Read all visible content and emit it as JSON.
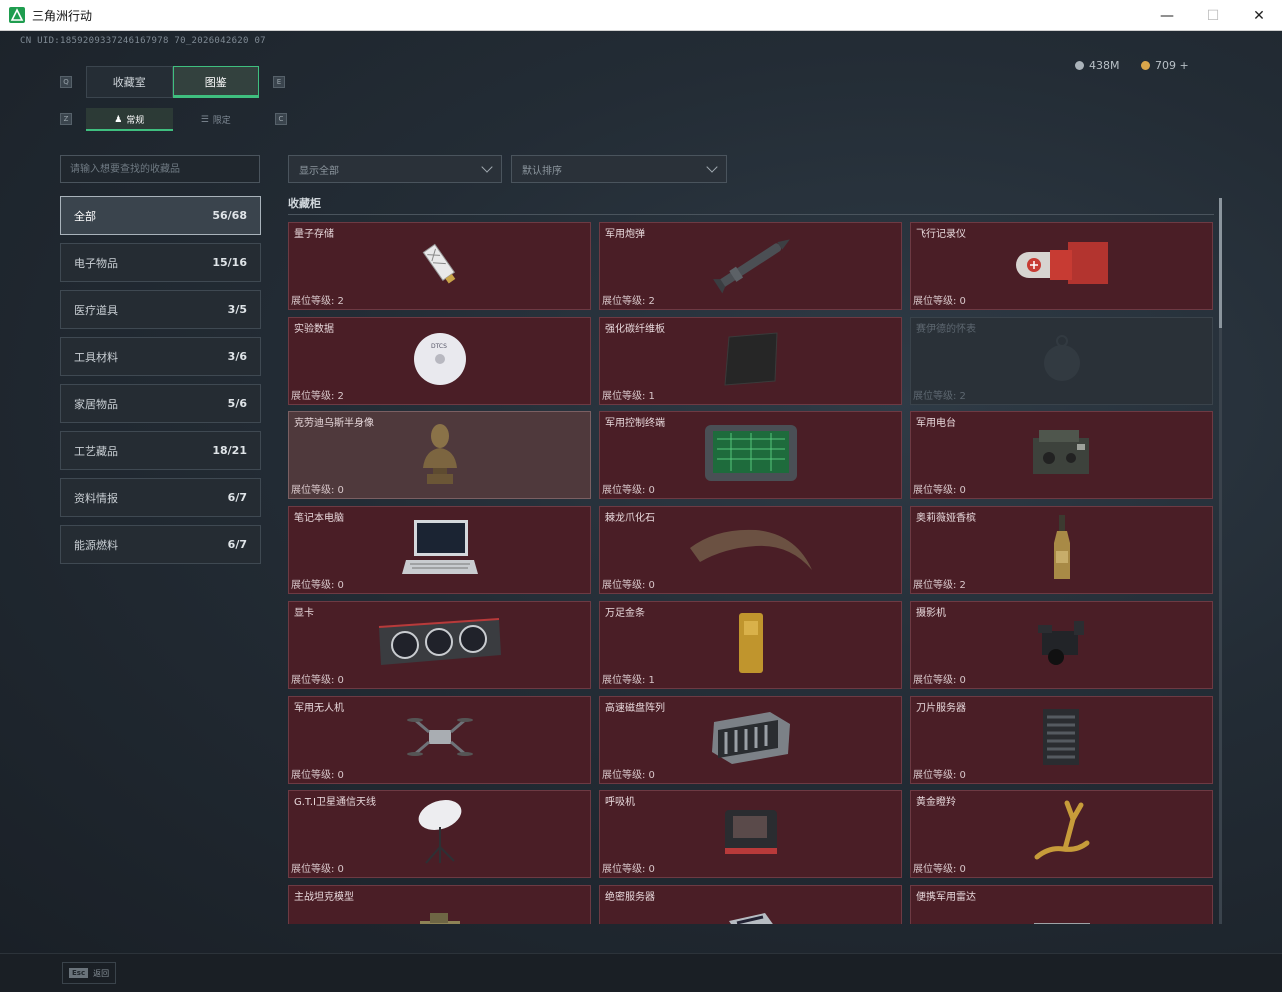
{
  "window": {
    "title": "三角洲行动",
    "minimize": "—",
    "maximize": "☐",
    "close": "✕"
  },
  "uid": "CN UID:1859209337246167978 70_2026042620 07",
  "currency": {
    "coins": "438M",
    "gems": "709 +"
  },
  "main_tabs": [
    {
      "label": "收藏室"
    },
    {
      "label": "图鉴"
    }
  ],
  "sub_tabs": [
    {
      "label": "常规"
    },
    {
      "label": "限定"
    }
  ],
  "search": {
    "placeholder": "请输入想要查找的收藏品"
  },
  "filters": {
    "display": "显示全部",
    "sort": "默认排序"
  },
  "categories": [
    {
      "label": "全部",
      "count": "56/68"
    },
    {
      "label": "电子物品",
      "count": "15/16"
    },
    {
      "label": "医疗道具",
      "count": "3/5"
    },
    {
      "label": "工具材料",
      "count": "3/6"
    },
    {
      "label": "家居物品",
      "count": "5/6"
    },
    {
      "label": "工艺藏品",
      "count": "18/21"
    },
    {
      "label": "资料情报",
      "count": "6/7"
    },
    {
      "label": "能源燃料",
      "count": "6/7"
    }
  ],
  "section_title": "收藏柜",
  "items": [
    {
      "name": "量子存储",
      "level": "展位等级: 2",
      "icon": "usb-drive-icon"
    },
    {
      "name": "军用炮弹",
      "level": "展位等级: 2",
      "icon": "artillery-shell-icon"
    },
    {
      "name": "飞行记录仪",
      "level": "展位等级: 0",
      "icon": "flight-recorder-icon"
    },
    {
      "name": "实验数据",
      "level": "展位等级: 2",
      "icon": "disc-icon"
    },
    {
      "name": "强化碳纤维板",
      "level": "展位等级: 1",
      "icon": "carbon-plate-icon"
    },
    {
      "name": "赛伊德的怀表",
      "level": "展位等级: 2",
      "icon": "pocket-watch-icon"
    },
    {
      "name": "克劳迪乌斯半身像",
      "level": "展位等级: 0",
      "icon": "bust-icon"
    },
    {
      "name": "军用控制终端",
      "level": "展位等级: 0",
      "icon": "terminal-icon"
    },
    {
      "name": "军用电台",
      "level": "展位等级: 0",
      "icon": "radio-icon"
    },
    {
      "name": "笔记本电脑",
      "level": "展位等级: 0",
      "icon": "laptop-icon"
    },
    {
      "name": "棘龙爪化石",
      "level": "展位等级: 0",
      "icon": "claw-fossil-icon"
    },
    {
      "name": "奥莉薇娅香槟",
      "level": "展位等级: 2",
      "icon": "champagne-icon"
    },
    {
      "name": "显卡",
      "level": "展位等级: 0",
      "icon": "gpu-icon"
    },
    {
      "name": "万足金条",
      "level": "展位等级: 1",
      "icon": "gold-bar-icon"
    },
    {
      "name": "摄影机",
      "level": "展位等级: 0",
      "icon": "camera-icon"
    },
    {
      "name": "军用无人机",
      "level": "展位等级: 0",
      "icon": "drone-icon"
    },
    {
      "name": "高速磁盘阵列",
      "level": "展位等级: 0",
      "icon": "disk-array-icon"
    },
    {
      "name": "刀片服务器",
      "level": "展位等级: 0",
      "icon": "blade-server-icon"
    },
    {
      "name": "G.T.I卫星通信天线",
      "level": "展位等级: 0",
      "icon": "satellite-dish-icon"
    },
    {
      "name": "呼吸机",
      "level": "展位等级: 0",
      "icon": "ventilator-icon"
    },
    {
      "name": "黄金瞪羚",
      "level": "展位等级: 0",
      "icon": "gold-gazelle-icon"
    },
    {
      "name": "主战坦克模型",
      "level": "",
      "icon": "tank-model-icon"
    },
    {
      "name": "绝密服务器",
      "level": "",
      "icon": "server-icon"
    },
    {
      "name": "便携军用雷达",
      "level": "",
      "icon": "radar-icon"
    }
  ],
  "colors": {
    "accent": "#3fbf7f",
    "card": "#4a1e26",
    "card_border": "#6d3a43"
  },
  "bottom": {
    "esc_key": "Esc",
    "back": "返回"
  }
}
